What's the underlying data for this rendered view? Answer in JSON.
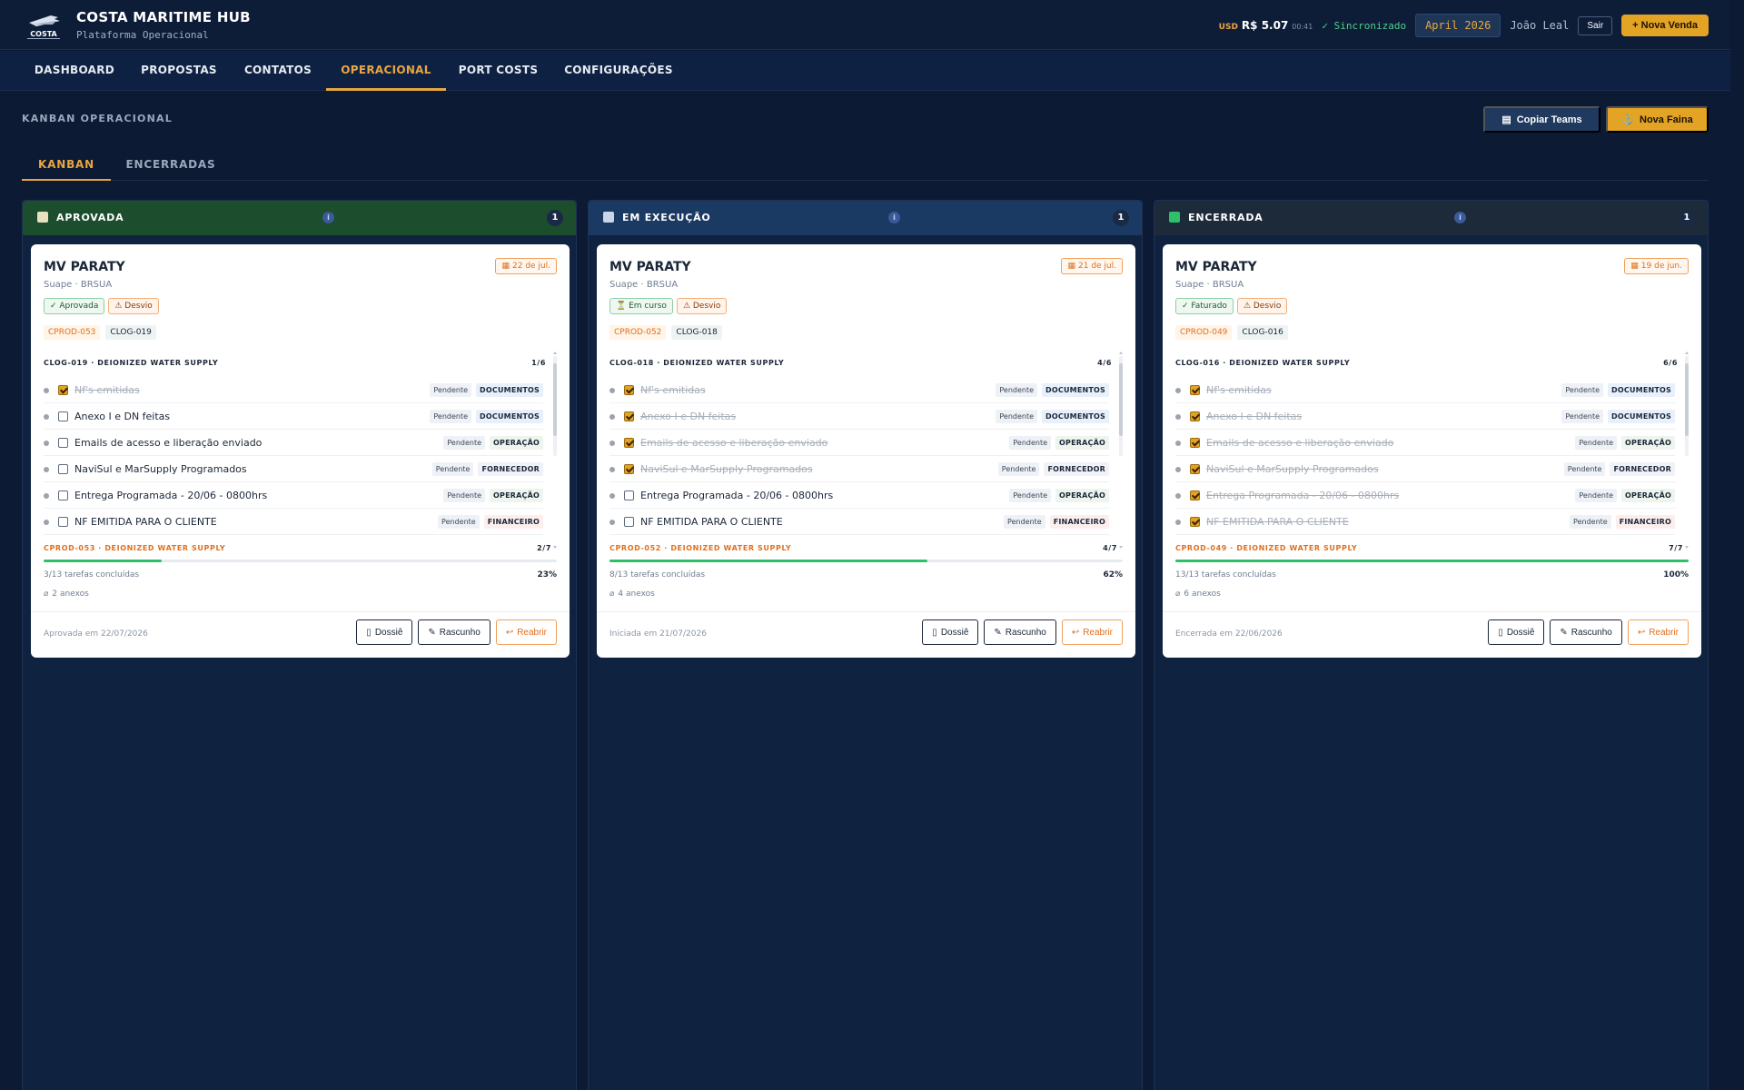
{
  "header": {
    "brand_title": "COSTA MARITIME HUB",
    "brand_subtitle": "Plataforma Operacional",
    "logo_text": "COSTA",
    "fx_currency": "USD",
    "fx_value": "R$ 5.07",
    "fx_time": "00:41",
    "sync_status": "✓ Sincronizado",
    "month": "April 2026",
    "user": "João Leal",
    "logout": "Sair",
    "new_sale": "+ Nova Venda"
  },
  "nav": [
    "DASHBOARD",
    "PROPOSTAS",
    "CONTATOS",
    "OPERACIONAL",
    "PORT COSTS",
    "CONFIGURAÇÕES"
  ],
  "nav_active": "OPERACIONAL",
  "page": {
    "section_title": "KANBAN OPERACIONAL",
    "copy_teams": "Copiar Teams",
    "new_faina": "Nova Faina",
    "tabs": [
      "KANBAN",
      "ENCERRADAS"
    ]
  },
  "colors": {
    "accent": "#e3a324",
    "aprovada": "#1c4d2c",
    "execucao": "#1a3a63",
    "encerrada": "#1d2a3a"
  },
  "columns": [
    {
      "title": "APROVADA",
      "icon": "clipboard-icon",
      "count": "1",
      "card": {
        "vessel": "MV PARATY",
        "port": "Suape · BRSUA",
        "date": "22 de jul.",
        "status": "✓ Aprovada",
        "flag": "⚠ Desvio",
        "cprod": "CPROD-053",
        "clog": "CLOG-019",
        "section": "CLOG-019 · DEIONIZED WATER SUPPLY",
        "section_count": "1/6",
        "tasks": [
          {
            "label": "Nf's emitidas",
            "status": "Pendente",
            "cat": "DOCUMENTOS",
            "done": true
          },
          {
            "label": "Anexo I e DN feitas",
            "status": "Pendente",
            "cat": "DOCUMENTOS",
            "done": false
          },
          {
            "label": "Emails de acesso e liberação enviado",
            "status": "Pendente",
            "cat": "OPERAÇÃO",
            "done": false
          },
          {
            "label": "NaviSul e MarSupply Programados",
            "status": "Pendente",
            "cat": "FORNECEDOR",
            "done": false
          },
          {
            "label": "Entrega Programada - 20/06 - 0800hrs",
            "status": "Pendente",
            "cat": "OPERAÇÃO",
            "done": false
          },
          {
            "label": "NF EMITIDA PARA O CLIENTE",
            "status": "Pendente",
            "cat": "FINANCEIRO",
            "done": false
          }
        ],
        "sub": "CPROD-053 · DEIONIZED WATER SUPPLY",
        "sub_count": "2/7",
        "progress_text": "3/13 tarefas concluídas",
        "progress_pct": "23%",
        "progress": 0.23,
        "attachments": "2 anexos",
        "footer": "Aprovada em 22/07/2026",
        "actions": [
          "Dossiê",
          "Rascunho",
          "Reabrir"
        ]
      }
    },
    {
      "title": "EM EXECUÇÃO",
      "icon": "gear-icon",
      "count": "1",
      "card": {
        "vessel": "MV PARATY",
        "port": "Suape · BRSUA",
        "date": "21 de jul.",
        "status": "⏳ Em curso",
        "flag": "⚠ Desvio",
        "cprod": "CPROD-052",
        "clog": "CLOG-018",
        "section": "CLOG-018 · DEIONIZED WATER SUPPLY",
        "section_count": "4/6",
        "tasks": [
          {
            "label": "Nf's emitidas",
            "status": "Pendente",
            "cat": "DOCUMENTOS",
            "done": true
          },
          {
            "label": "Anexo I e DN feitas",
            "status": "Pendente",
            "cat": "DOCUMENTOS",
            "done": true
          },
          {
            "label": "Emails de acesso e liberação enviado",
            "status": "Pendente",
            "cat": "OPERAÇÃO",
            "done": true
          },
          {
            "label": "NaviSul e MarSupply Programados",
            "status": "Pendente",
            "cat": "FORNECEDOR",
            "done": true
          },
          {
            "label": "Entrega Programada - 20/06 - 0800hrs",
            "status": "Pendente",
            "cat": "OPERAÇÃO",
            "done": false
          },
          {
            "label": "NF EMITIDA PARA O CLIENTE",
            "status": "Pendente",
            "cat": "FINANCEIRO",
            "done": false
          }
        ],
        "sub": "CPROD-052 · DEIONIZED WATER SUPPLY",
        "sub_count": "4/7",
        "progress_text": "8/13 tarefas concluídas",
        "progress_pct": "62%",
        "progress": 0.62,
        "attachments": "4 anexos",
        "footer": "Iniciada em 21/07/2026",
        "actions": [
          "Dossiê",
          "Rascunho",
          "Reabrir"
        ]
      }
    },
    {
      "title": "ENCERRADA",
      "icon": "check-square-icon",
      "count": "1",
      "card": {
        "vessel": "MV PARATY",
        "port": "Suape · BRSUA",
        "date": "19 de jun.",
        "status": "✓ Faturado",
        "flag": "⚠ Desvio",
        "cprod": "CPROD-049",
        "clog": "CLOG-016",
        "section": "CLOG-016 · DEIONIZED WATER SUPPLY",
        "section_count": "6/6",
        "tasks": [
          {
            "label": "Nf's emitidas",
            "status": "Pendente",
            "cat": "DOCUMENTOS",
            "done": true
          },
          {
            "label": "Anexo I e DN feitas",
            "status": "Pendente",
            "cat": "DOCUMENTOS",
            "done": true
          },
          {
            "label": "Emails de acesso e liberação enviado",
            "status": "Pendente",
            "cat": "OPERAÇÃO",
            "done": true
          },
          {
            "label": "NaviSul e MarSupply Programados",
            "status": "Pendente",
            "cat": "FORNECEDOR",
            "done": true
          },
          {
            "label": "Entrega Programada - 20/06 - 0800hrs",
            "status": "Pendente",
            "cat": "OPERAÇÃO",
            "done": true
          },
          {
            "label": "NF EMITIDA PARA O CLIENTE",
            "status": "Pendente",
            "cat": "FINANCEIRO",
            "done": true
          }
        ],
        "sub": "CPROD-049 · DEIONIZED WATER SUPPLY",
        "sub_count": "7/7",
        "progress_text": "13/13 tarefas concluídas",
        "progress_pct": "100%",
        "progress": 1.0,
        "attachments": "6 anexos",
        "footer": "Encerrada em 22/06/2026",
        "actions": [
          "Dossiê",
          "Rascunho",
          "Reabrir"
        ]
      }
    }
  ]
}
